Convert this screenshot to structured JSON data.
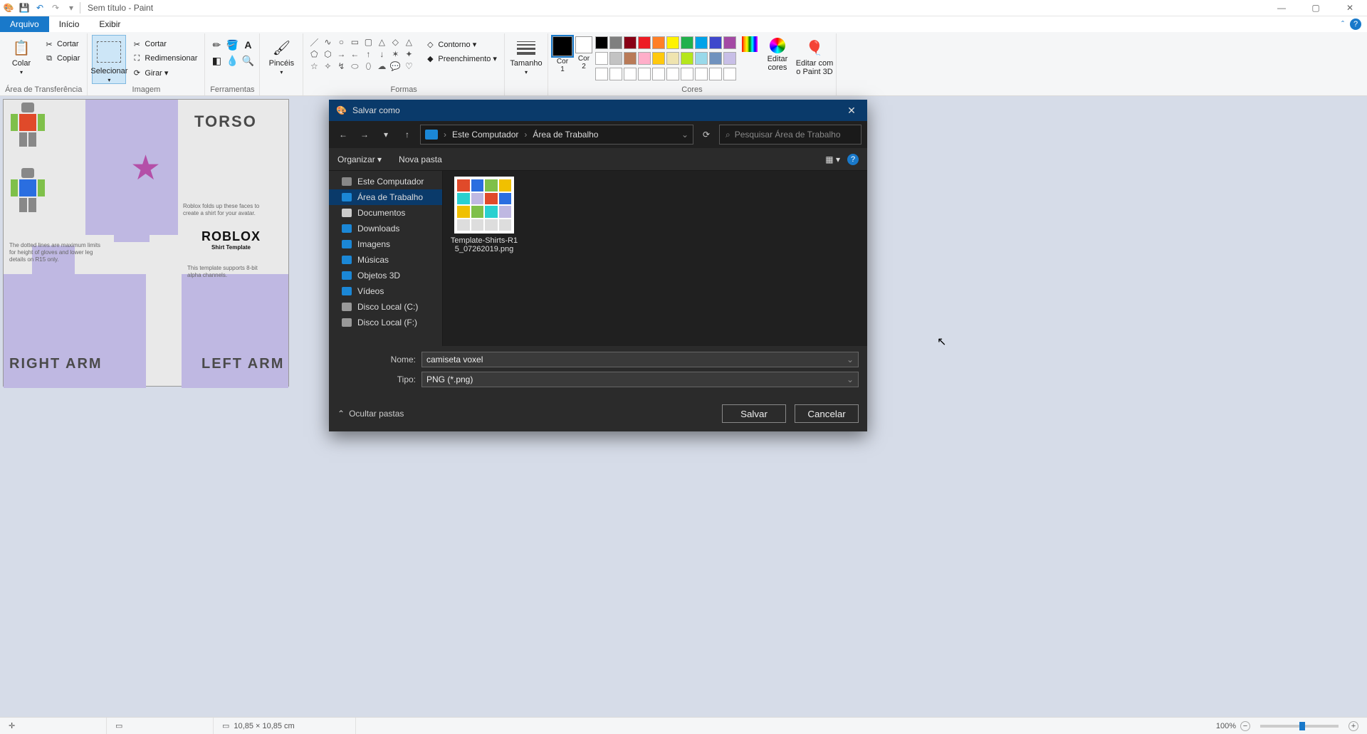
{
  "window": {
    "title": "Sem título - Paint",
    "minimize": "—",
    "maximize": "▢",
    "close": "✕"
  },
  "qat": {
    "undo": "↶",
    "redo": "↷",
    "save": "💾",
    "customize": "▾"
  },
  "tabs": {
    "file": "Arquivo",
    "home": "Início",
    "view": "Exibir",
    "collapse": "ˆ",
    "help": "?"
  },
  "ribbon": {
    "clipboard": {
      "label": "Área de Transferência",
      "paste": "Colar",
      "cut": "Cortar",
      "copy": "Copiar"
    },
    "image": {
      "label": "Imagem",
      "select": "Selecionar",
      "crop": "Cortar",
      "resize": "Redimensionar",
      "rotate": "Girar ▾"
    },
    "tools": {
      "label": "Ferramentas"
    },
    "brushes": {
      "label": "Pincéis"
    },
    "shapes": {
      "label": "Formas",
      "outline": "Contorno ▾",
      "fill": "Preenchimento ▾"
    },
    "size": {
      "label": "Tamanho"
    },
    "colors": {
      "label": "Cores",
      "c1": "Cor\n1",
      "c2": "Cor\n2",
      "edit": "Editar\ncores",
      "paint3d": "Editar com\no Paint 3D",
      "color1": "#000000",
      "color2": "#ffffff",
      "palette_top": [
        "#000000",
        "#7f7f7f",
        "#880015",
        "#ed1c24",
        "#ff7f27",
        "#fff200",
        "#22b14c",
        "#00a2e8",
        "#3f48cc",
        "#a349a4"
      ],
      "palette_mid": [
        "#ffffff",
        "#c3c3c3",
        "#b97a57",
        "#ffaec9",
        "#ffc90e",
        "#efe4b0",
        "#b5e61d",
        "#99d9ea",
        "#7092be",
        "#c8bfe7"
      ],
      "palette_bot": [
        "#ffffff",
        "#ffffff",
        "#ffffff",
        "#ffffff",
        "#ffffff",
        "#ffffff",
        "#ffffff",
        "#ffffff",
        "#ffffff",
        "#ffffff"
      ]
    }
  },
  "canvas": {
    "torso": "TORSO",
    "right_arm": "RIGHT ARM",
    "left_arm": "LEFT ARM",
    "note1": "Roblox folds up these faces to create a shirt for your avatar.",
    "note2": "The dotted lines are maximum limits for height of gloves and lower leg details on R15 only.",
    "note3": "This template supports 8-bit alpha channels.",
    "logo_main": "ROBLOX",
    "logo_sub": "Shirt Template"
  },
  "status": {
    "coords": "",
    "selection": "",
    "size": "10,85 × 10,85 cm",
    "zoom": "100%"
  },
  "dialog": {
    "title": "Salvar como",
    "back": "←",
    "forward": "→",
    "up": "↑",
    "refresh": "⟳",
    "crumb1": "Este Computador",
    "crumb2": "Área de Trabalho",
    "search_placeholder": "Pesquisar Área de Trabalho",
    "organize": "Organizar ▾",
    "newfolder": "Nova pasta",
    "viewmode": "▦ ▾",
    "help": "?",
    "tree": {
      "computer": "Este Computador",
      "desktop": "Área de Trabalho",
      "documents": "Documentos",
      "downloads": "Downloads",
      "images": "Imagens",
      "music": "Músicas",
      "objects3d": "Objetos 3D",
      "videos": "Vídeos",
      "diskc": "Disco Local (C:)",
      "diskf": "Disco Local (F:)"
    },
    "file_name": "Template-Shirts-R15_07262019.png",
    "name_label": "Nome:",
    "type_label": "Tipo:",
    "name_value": "camiseta voxel",
    "type_value": "PNG (*.png)",
    "hide_folders": "Ocultar pastas",
    "save": "Salvar",
    "cancel": "Cancelar"
  }
}
